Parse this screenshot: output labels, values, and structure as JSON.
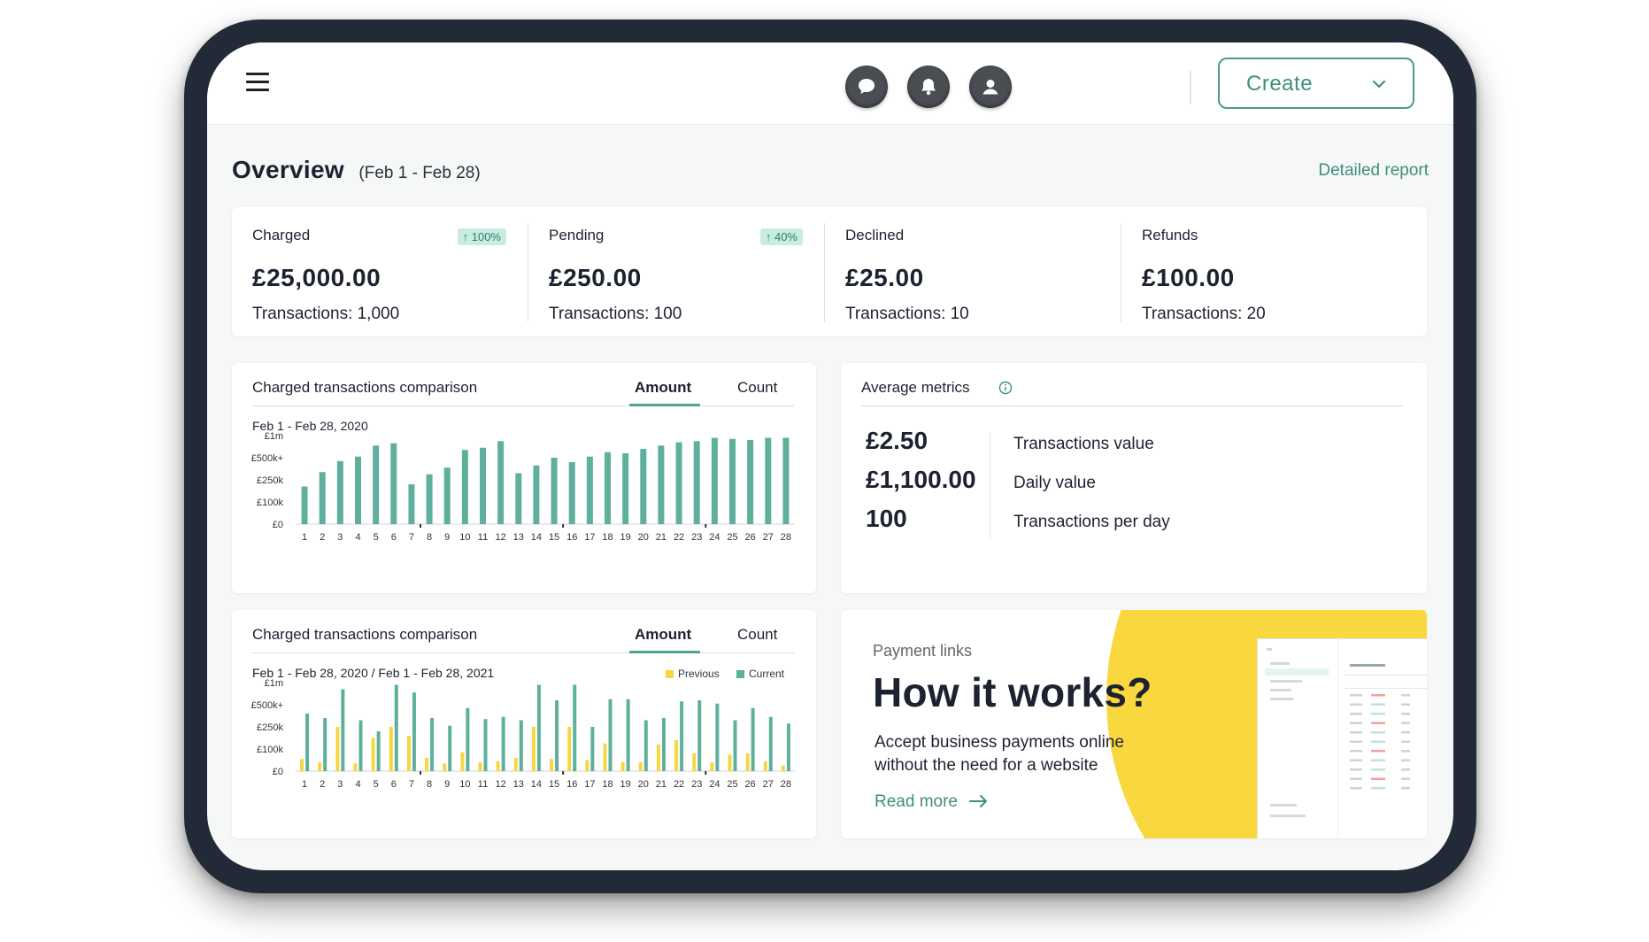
{
  "header": {
    "menu_icon": "hamburger-menu-icon",
    "icons": [
      "chat-bubble-icon",
      "bell-icon",
      "user-avatar-icon"
    ],
    "create_label": "Create",
    "accent_color": "#3f8f7c"
  },
  "overview": {
    "title": "Overview",
    "range": "(Feb 1 - Feb 28)",
    "detailed_link": "Detailed report"
  },
  "stats": [
    {
      "label": "Charged",
      "badge": "↑ 100%",
      "value": "£25,000.00",
      "transactions": "Transactions: 1,000"
    },
    {
      "label": "Pending",
      "badge": "↑ 40%",
      "value": "£250.00",
      "transactions": "Transactions: 100"
    },
    {
      "label": "Declined",
      "badge": "",
      "value": "£25.00",
      "transactions": "Transactions: 10"
    },
    {
      "label": "Refunds",
      "badge": "",
      "value": "£100.00",
      "transactions": "Transactions: 20"
    }
  ],
  "chart1": {
    "title": "Charged transactions comparison",
    "tabs": [
      "Amount",
      "Count"
    ],
    "range": "Feb 1 - Feb 28, 2020"
  },
  "chart2": {
    "title": "Charged transactions comparison",
    "tabs": [
      "Amount",
      "Count"
    ],
    "range": "Feb 1 - Feb 28, 2020 / Feb 1 - Feb 28, 2021",
    "legend_previous": "Previous",
    "legend_current": "Current"
  },
  "average": {
    "title": "Average metrics",
    "values": [
      "£2.50",
      "£1,100.00",
      "100"
    ],
    "labels": [
      "Transactions value",
      "Daily value",
      "Transactions per day"
    ]
  },
  "promo": {
    "kicker": "Payment links",
    "headline": "How it works?",
    "body": "Accept business payments online without the need for a website",
    "link": "Read more",
    "accent_color": "#f9d73f"
  },
  "chart_data": [
    {
      "type": "bar",
      "title": "Charged transactions comparison",
      "categories": [
        "1",
        "2",
        "3",
        "4",
        "5",
        "6",
        "7",
        "8",
        "9",
        "10",
        "11",
        "12",
        "13",
        "14",
        "15",
        "16",
        "17",
        "18",
        "19",
        "20",
        "21",
        "22",
        "23",
        "24",
        "25",
        "26",
        "27",
        "28"
      ],
      "y_ticks": [
        "£0",
        "£100k",
        "£250k",
        "£500k+",
        "£1m"
      ],
      "series": [
        {
          "name": "Current",
          "color": "#5eb09c",
          "values": [
            1.7,
            2.35,
            2.85,
            3.05,
            3.55,
            3.65,
            1.8,
            2.25,
            2.55,
            3.35,
            3.45,
            3.75,
            2.3,
            2.65,
            3.0,
            2.8,
            3.05,
            3.25,
            3.2,
            3.4,
            3.55,
            3.7,
            3.75,
            3.9,
            3.85,
            3.8,
            3.9,
            3.9
          ]
        }
      ]
    },
    {
      "type": "bar",
      "title": "Charged transactions comparison",
      "categories": [
        "1",
        "2",
        "3",
        "4",
        "5",
        "6",
        "7",
        "8",
        "9",
        "10",
        "11",
        "12",
        "13",
        "14",
        "15",
        "16",
        "17",
        "18",
        "19",
        "20",
        "21",
        "22",
        "23",
        "24",
        "25",
        "26",
        "27",
        "28"
      ],
      "y_ticks": [
        "£0",
        "£100k",
        "£250k",
        "£500k+",
        "£1m"
      ],
      "series": [
        {
          "name": "Previous",
          "color": "#f5d742",
          "values": [
            0.55,
            0.4,
            2.0,
            0.35,
            1.5,
            2.0,
            1.6,
            0.6,
            0.35,
            0.85,
            0.4,
            0.45,
            0.6,
            2.0,
            0.55,
            2.0,
            0.5,
            1.25,
            0.4,
            0.4,
            1.2,
            1.4,
            0.8,
            0.4,
            0.75,
            0.8,
            0.45,
            0.25
          ]
        },
        {
          "name": "Current",
          "color": "#5eb09c",
          "values": [
            2.6,
            2.4,
            3.7,
            2.3,
            1.8,
            3.9,
            3.55,
            2.4,
            2.05,
            2.85,
            2.35,
            2.45,
            2.3,
            3.9,
            3.2,
            3.9,
            2.0,
            3.25,
            3.25,
            2.3,
            2.4,
            3.15,
            3.2,
            3.05,
            2.3,
            2.85,
            2.45,
            2.15
          ]
        }
      ]
    }
  ]
}
